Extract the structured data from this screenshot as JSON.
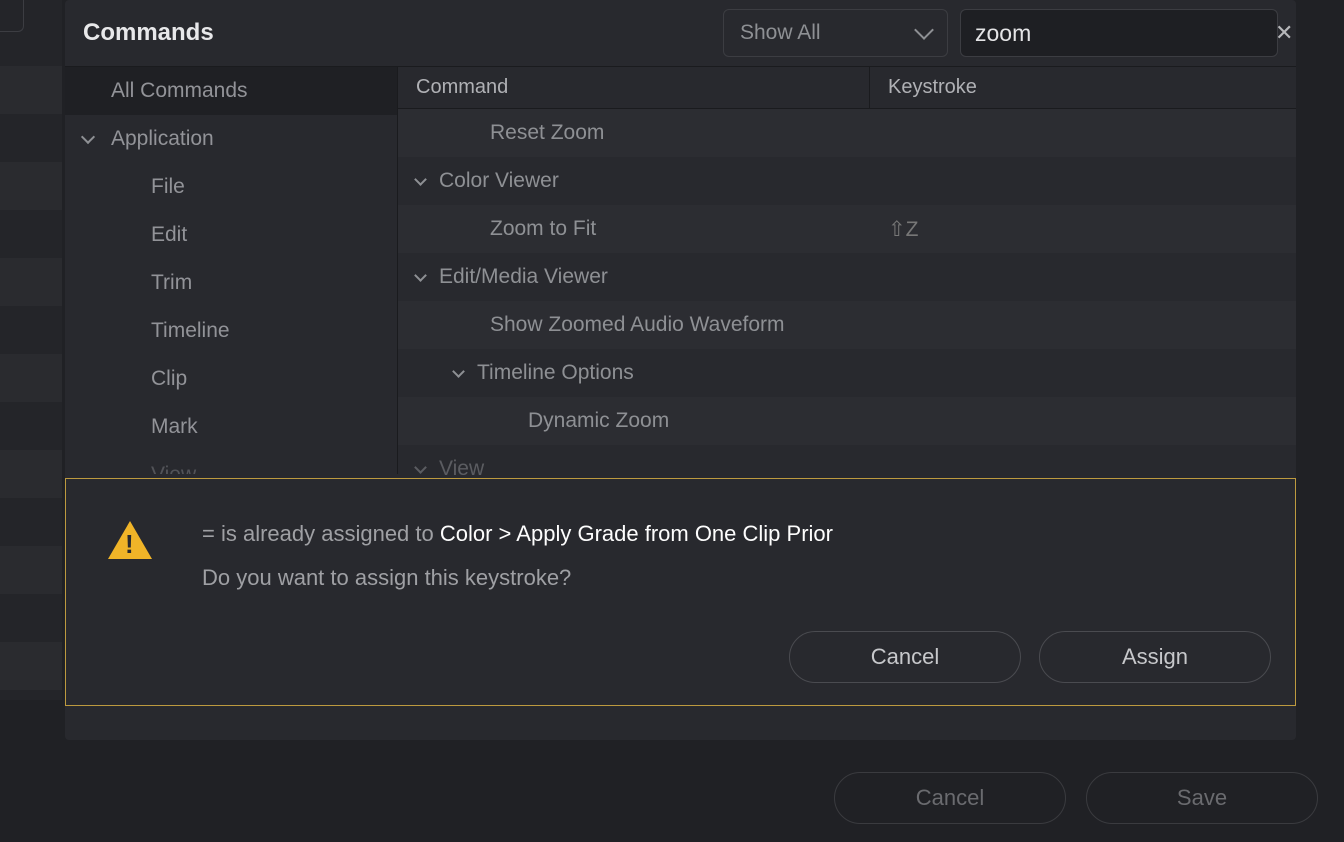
{
  "title": "Commands",
  "filter": {
    "label": "Show All"
  },
  "search": {
    "value": "zoom"
  },
  "sidebar": {
    "all": "All Commands",
    "group": "Application",
    "items": [
      "File",
      "Edit",
      "Trim",
      "Timeline",
      "Clip",
      "Mark",
      "View"
    ]
  },
  "table": {
    "headers": {
      "command": "Command",
      "keystroke": "Keystroke"
    },
    "rows": [
      {
        "label": "Reset Zoom",
        "indent": 2,
        "expand": false,
        "keystroke": ""
      },
      {
        "label": "Color Viewer",
        "indent": 0,
        "expand": true,
        "keystroke": ""
      },
      {
        "label": "Zoom to Fit",
        "indent": 2,
        "expand": false,
        "keystroke": "⇧Z"
      },
      {
        "label": "Edit/Media Viewer",
        "indent": 0,
        "expand": true,
        "keystroke": ""
      },
      {
        "label": "Show Zoomed Audio Waveform",
        "indent": 2,
        "expand": false,
        "keystroke": ""
      },
      {
        "label": "Timeline Options",
        "indent": 1,
        "expand": true,
        "keystroke": ""
      },
      {
        "label": "Dynamic Zoom",
        "indent": 3,
        "expand": false,
        "keystroke": ""
      },
      {
        "label": "View",
        "indent": 0,
        "expand": true,
        "keystroke": ""
      }
    ]
  },
  "alert": {
    "prefix": "= is already assigned to ",
    "bold": "Color > Apply Grade from One Clip Prior",
    "question": "Do you want to assign this keystroke?",
    "cancel": "Cancel",
    "assign": "Assign"
  },
  "footer": {
    "cancel": "Cancel",
    "save": "Save"
  }
}
